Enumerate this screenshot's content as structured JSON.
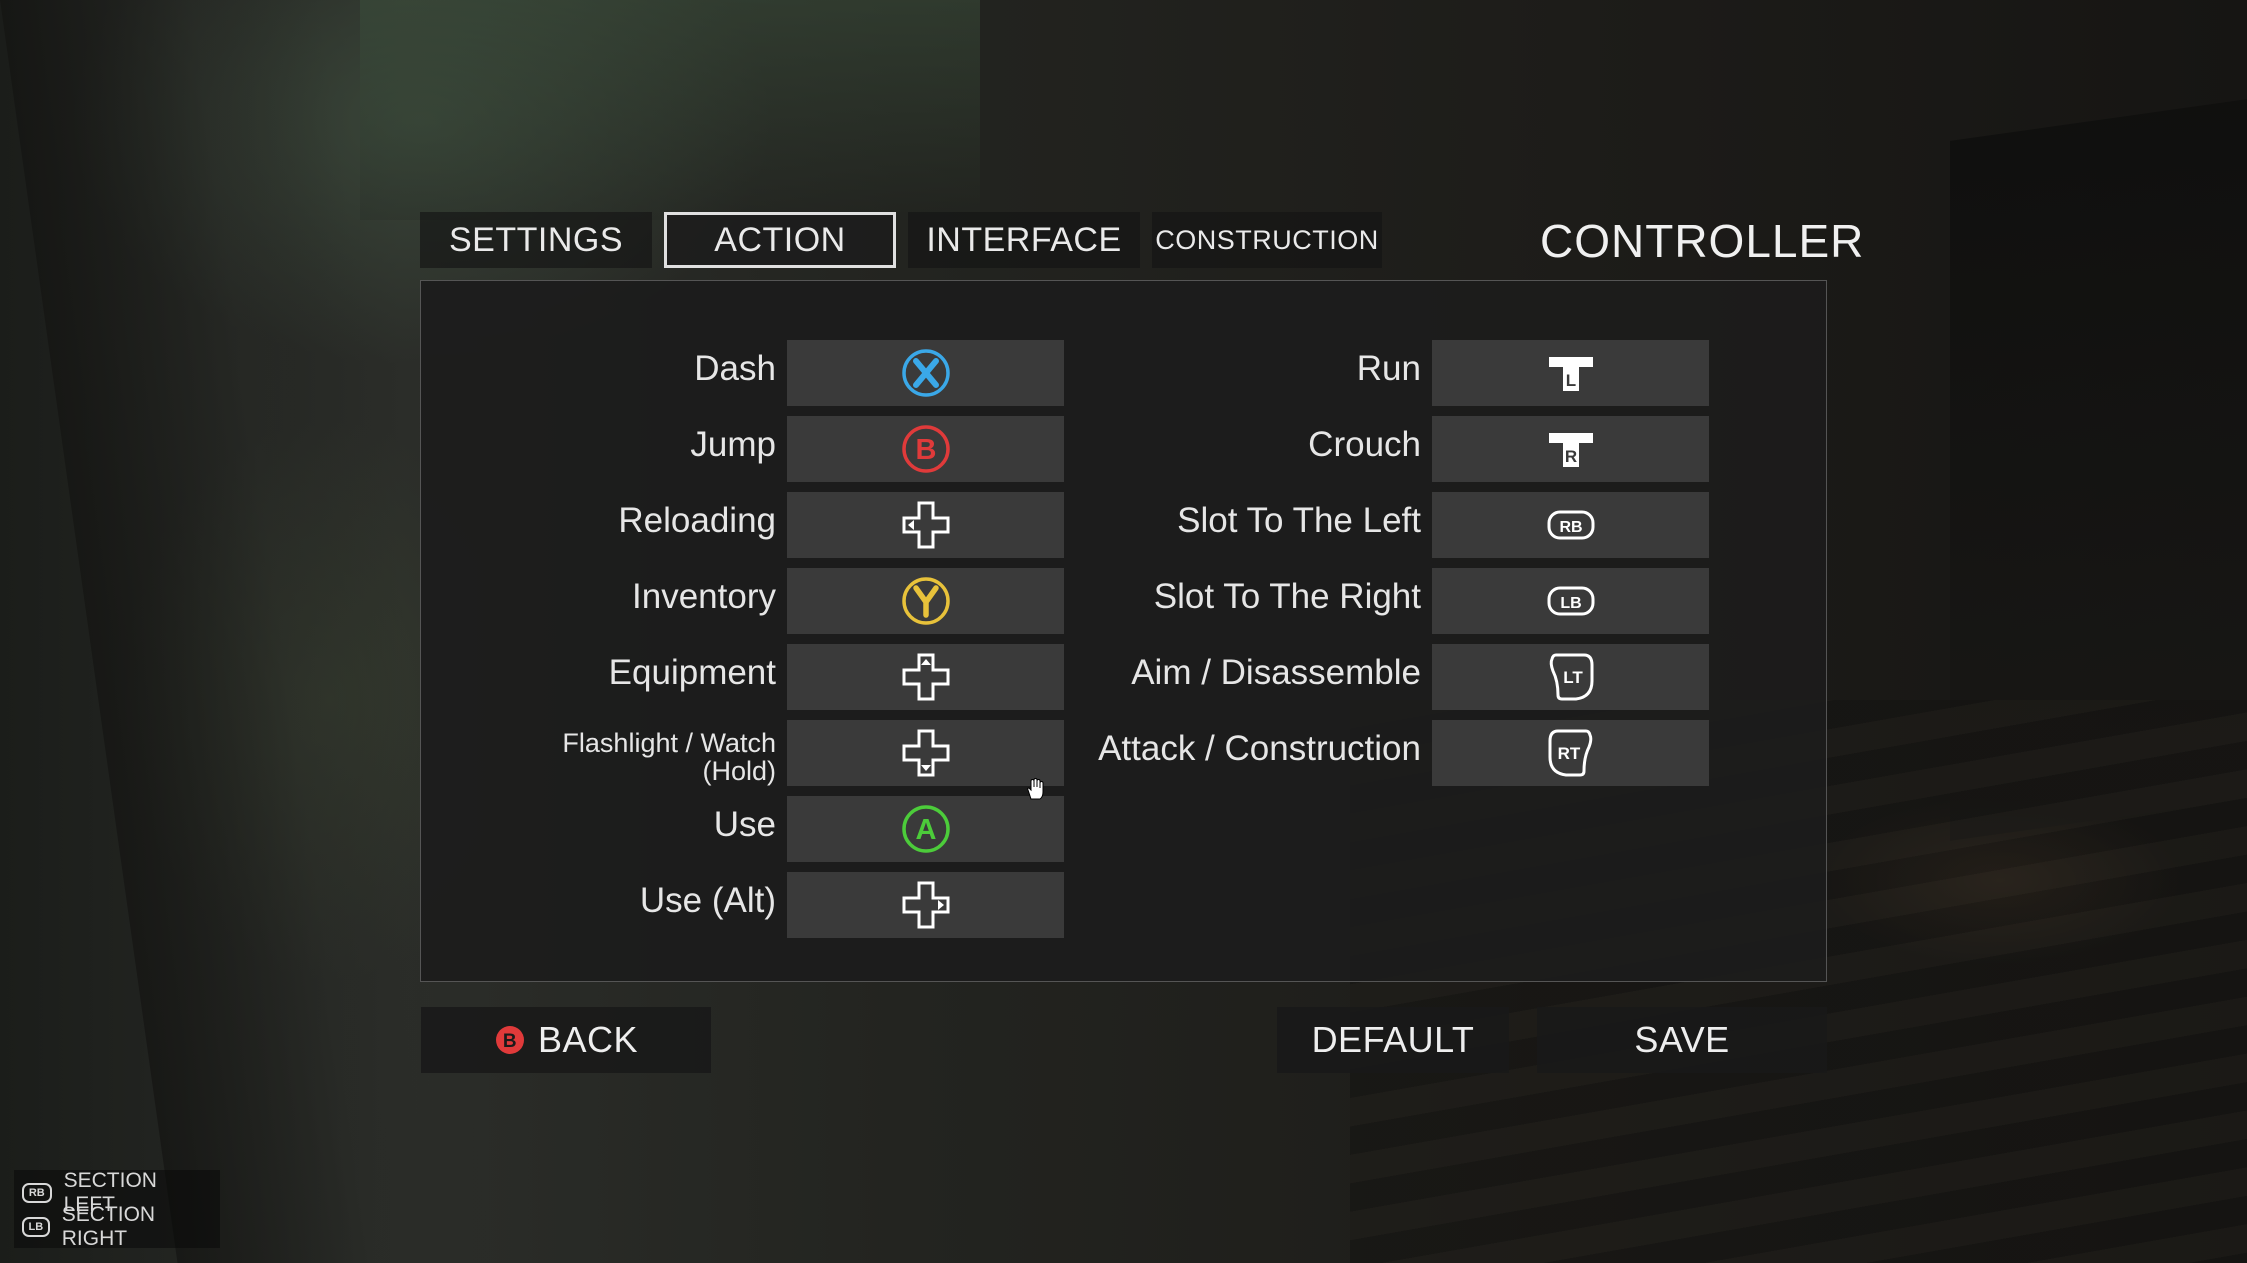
{
  "tabs": [
    {
      "label": "SETTINGS",
      "active": false
    },
    {
      "label": "ACTION",
      "active": true
    },
    {
      "label": "INTERFACE",
      "active": false
    },
    {
      "label": "CONSTRUCTION",
      "active": false
    }
  ],
  "section_title": "CONTROLLER",
  "left_bindings": [
    {
      "action": "Dash",
      "button": "X",
      "icon": "x-button-icon"
    },
    {
      "action": "Jump",
      "button": "B",
      "icon": "b-button-icon"
    },
    {
      "action": "Reloading",
      "button": "D-pad Left",
      "icon": "dpad-left-icon"
    },
    {
      "action": "Inventory",
      "button": "Y",
      "icon": "y-button-icon"
    },
    {
      "action": "Equipment",
      "button": "D-pad Up",
      "icon": "dpad-up-icon"
    },
    {
      "action": "Flashlight / Watch (Hold)",
      "button": "D-pad Down",
      "icon": "dpad-down-icon"
    },
    {
      "action": "Use",
      "button": "A",
      "icon": "a-button-icon"
    },
    {
      "action": "Use (Alt)",
      "button": "D-pad Right",
      "icon": "dpad-right-icon"
    }
  ],
  "right_bindings": [
    {
      "action": "Run",
      "button": "L",
      "icon": "left-stick-icon"
    },
    {
      "action": "Crouch",
      "button": "R",
      "icon": "right-stick-icon"
    },
    {
      "action": "Slot To The Left",
      "button": "RB",
      "icon": "rb-button-icon"
    },
    {
      "action": "Slot To The Right",
      "button": "LB",
      "icon": "lb-button-icon"
    },
    {
      "action": "Aim / Disassemble",
      "button": "LT",
      "icon": "lt-trigger-icon"
    },
    {
      "action": "Attack / Construction",
      "button": "RT",
      "icon": "rt-trigger-icon"
    }
  ],
  "buttons": {
    "back": "BACK",
    "back_glyph": "B",
    "default": "DEFAULT",
    "save": "SAVE"
  },
  "hints": [
    {
      "badge": "RB",
      "label": "SECTION LEFT"
    },
    {
      "badge": "LB",
      "label": "SECTION RIGHT"
    }
  ],
  "colors": {
    "x_button": "#3aa8e8",
    "b_button": "#e03a3a",
    "y_button": "#e8c23a",
    "a_button": "#4ccc3a",
    "panel_bg": "#1c1c1c",
    "binding_bg": "#3a3a3a"
  }
}
